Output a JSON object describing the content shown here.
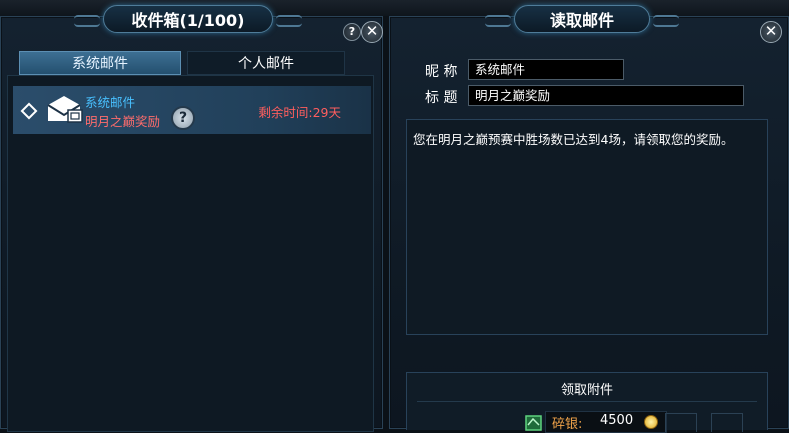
{
  "inbox": {
    "title": "收件箱(1/100)",
    "help_glyph": "?",
    "close_glyph": "✕",
    "tabs": [
      {
        "label": "系统邮件",
        "active": true
      },
      {
        "label": "个人邮件",
        "active": false
      }
    ],
    "mails": [
      {
        "sender": "系统邮件",
        "subject": "明月之巅奖励",
        "remaining": "剩余时间:29天",
        "icon": "envelope-icon"
      }
    ]
  },
  "reader": {
    "title": "读取邮件",
    "close_glyph": "✕",
    "nickname_label": "昵 称",
    "nickname_value": "系统邮件",
    "subject_label": "标 题",
    "subject_value": "明月之巅奖励",
    "body": "您在明月之巅预赛中胜场数已达到4场，请领取您的奖励。",
    "attachment": {
      "title": "领取附件",
      "currency_label": "碎银:",
      "currency_amount": "4500",
      "coin_icon": "coin-icon"
    }
  },
  "colors": {
    "accent_blue": "#48c0ff",
    "alert_red": "#ff5e5e",
    "currency_orange": "#f0a34a",
    "panel_bg": "#142230"
  }
}
